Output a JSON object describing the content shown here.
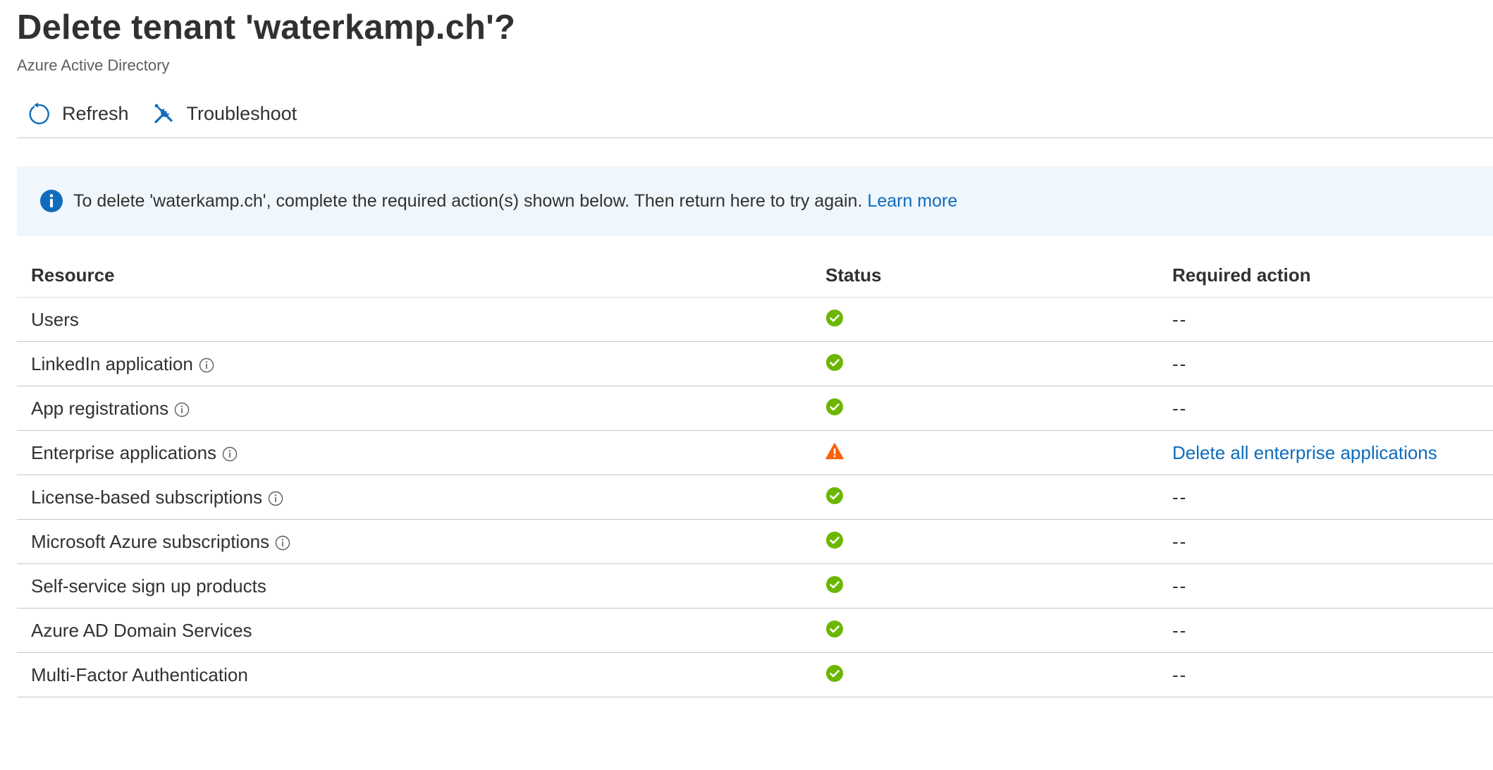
{
  "header": {
    "title": "Delete tenant 'waterkamp.ch'?",
    "subtitle": "Azure Active Directory"
  },
  "toolbar": {
    "refresh": {
      "label": "Refresh",
      "icon": "refresh-icon"
    },
    "troubleshoot": {
      "label": "Troubleshoot",
      "icon": "wrench-screwdriver-icon"
    }
  },
  "infobar": {
    "icon": "info-icon",
    "message": "To delete 'waterkamp.ch', complete the required action(s) shown below. Then return here to try again.",
    "link": "Learn more"
  },
  "table": {
    "columns": {
      "resource": "Resource",
      "status": "Status",
      "action": "Required action"
    },
    "rows": [
      {
        "resource": "Users",
        "info": false,
        "status": "ok",
        "action": "--",
        "action_is_link": false
      },
      {
        "resource": "LinkedIn application",
        "info": true,
        "status": "ok",
        "action": "--",
        "action_is_link": false
      },
      {
        "resource": "App registrations",
        "info": true,
        "status": "ok",
        "action": "--",
        "action_is_link": false
      },
      {
        "resource": "Enterprise applications",
        "info": true,
        "status": "warning",
        "action": "Delete all enterprise applications",
        "action_is_link": true
      },
      {
        "resource": "License-based subscriptions",
        "info": true,
        "status": "ok",
        "action": "--",
        "action_is_link": false
      },
      {
        "resource": "Microsoft Azure subscriptions",
        "info": true,
        "status": "ok",
        "action": "--",
        "action_is_link": false
      },
      {
        "resource": "Self-service sign up products",
        "info": false,
        "status": "ok",
        "action": "--",
        "action_is_link": false
      },
      {
        "resource": "Azure AD Domain Services",
        "info": false,
        "status": "ok",
        "action": "--",
        "action_is_link": false
      },
      {
        "resource": "Multi-Factor Authentication",
        "info": false,
        "status": "ok",
        "action": "--",
        "action_is_link": false
      }
    ]
  },
  "colors": {
    "link": "#0f6cbd",
    "success": "#6bb700",
    "warning": "#f7630c",
    "info_bg": "#eff6fc",
    "info_icon": "#0f6cbd"
  }
}
